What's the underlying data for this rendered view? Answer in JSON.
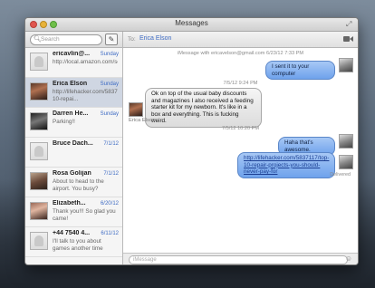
{
  "window": {
    "title": "Messages"
  },
  "sidebar": {
    "search_placeholder": "Search",
    "conversations": [
      {
        "name": "ericavlin@...",
        "date": "Sunday",
        "preview": "http://local.amazon.com/se...",
        "avatar": "blank"
      },
      {
        "name": "Erica Elson",
        "date": "Sunday",
        "preview": "http://lifehacker.com/5837117/top-10-repai...",
        "avatar": "photo-a",
        "selected": true
      },
      {
        "name": "Darren He...",
        "date": "Sunday",
        "preview": "Parking!!",
        "avatar": "photo-b"
      },
      {
        "name": "Bruce Dach...",
        "date": "7/1/12",
        "preview": "",
        "avatar": "blank"
      },
      {
        "name": "Rosa Golijan",
        "date": "7/1/12",
        "preview": "About to head to the airport. You busy?",
        "avatar": "photo-c"
      },
      {
        "name": "Elizabeth...",
        "date": "6/20/12",
        "preview": "Thank you!!! So glad you came!",
        "avatar": "photo-d"
      },
      {
        "name": "+44 7540 4...",
        "date": "6/11/12",
        "preview": "I'll talk to you about games another time",
        "avatar": "blank"
      }
    ]
  },
  "conversation": {
    "to_label": "To:",
    "to_name": "Erica Elson",
    "imessage_header": "iMessage with ericavelson@gmail.com 6/23/12 7:33 PM",
    "ts1": "7/5/12 9:24 PM",
    "ts2": "7/5/12 10:20 PM",
    "msg1": "I sent it to your computer",
    "msg2": "Ok on top of the usual baby discounts and magazines I also received a feeding starter kit for my newborn. It's like in a box and everything. This is fucking weird.",
    "msg2_sender": "Erica Elson",
    "msg3": "Haha that's awesome.",
    "msg4": "http://lifehacker.com/5837117/top-10-repair-projects-you-should-never-pay-for",
    "delivered": "Delivered",
    "input_placeholder": "iMessage"
  },
  "colors": {
    "accent": "#3f6cc4",
    "outgoing_bubble": "#6ea2ec",
    "incoming_bubble": "#dcdcdc"
  }
}
